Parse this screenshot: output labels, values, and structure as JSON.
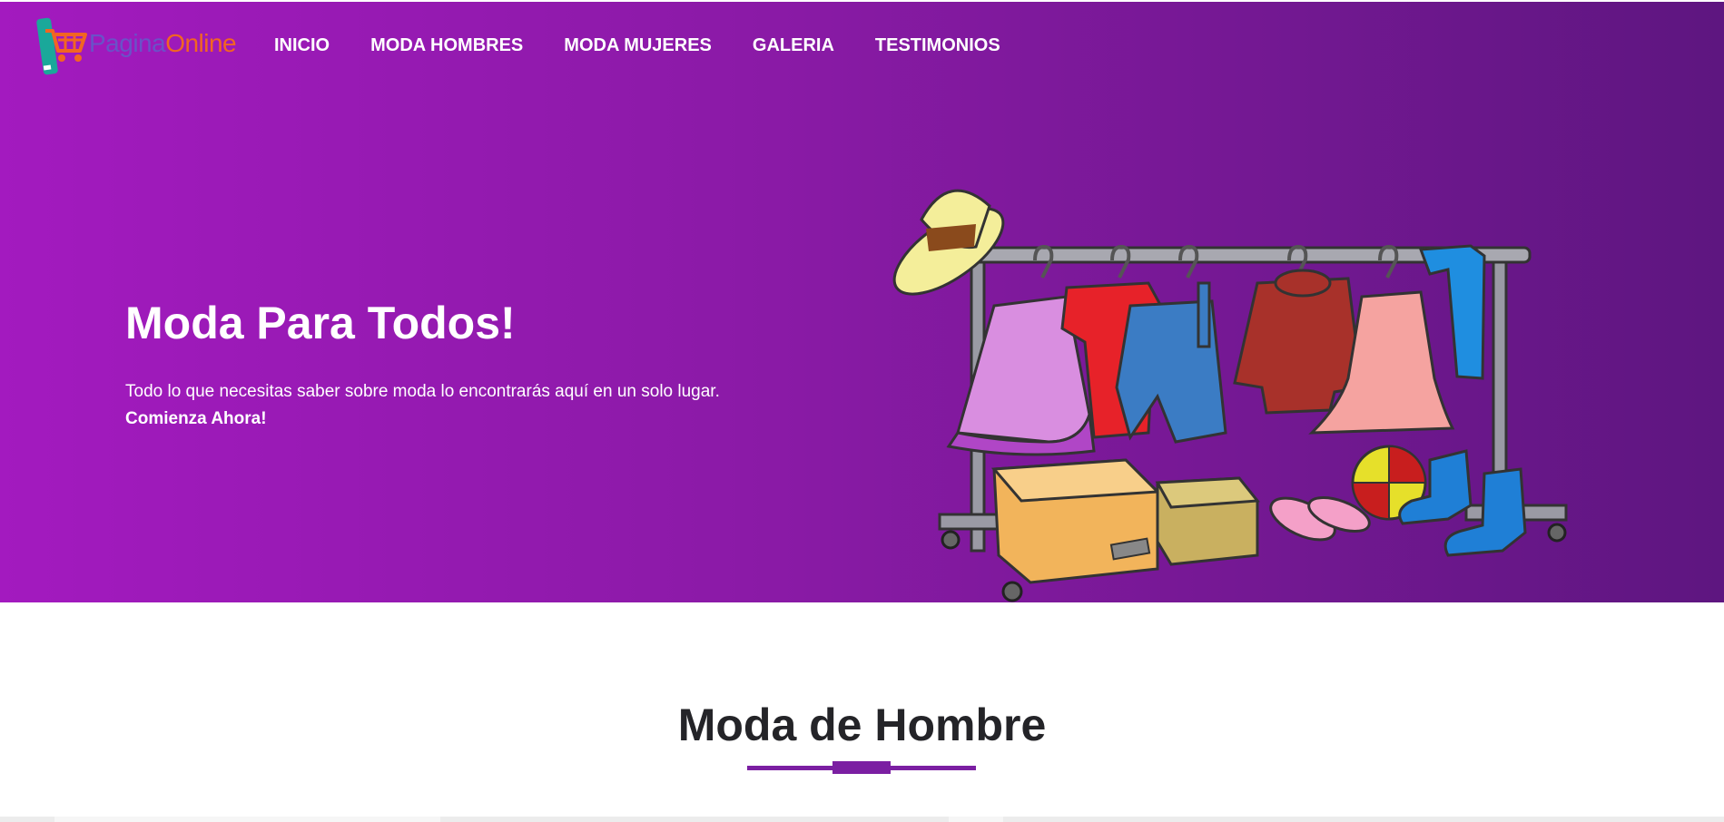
{
  "brand": {
    "name_part1": "Pagina",
    "name_part2": "Online",
    "icon": "shopping-cart-phone-logo"
  },
  "nav": {
    "items": [
      {
        "label": "INICIO"
      },
      {
        "label": "MODA HOMBRES"
      },
      {
        "label": "MODA MUJERES"
      },
      {
        "label": "GALERIA"
      },
      {
        "label": "TESTIMONIOS"
      }
    ]
  },
  "hero": {
    "title": "Moda Para Todos!",
    "description": "Todo lo que necesitas saber sobre moda lo encontrarás aquí en un solo lugar.",
    "cta": "Comienza Ahora!",
    "illustration": "clothing-rack-illustration"
  },
  "section": {
    "title": "Moda de Hombre"
  },
  "colors": {
    "hero_gradient_start": "#a31abf",
    "hero_gradient_end": "#5e1680",
    "accent": "#7b1fa2",
    "logo_blue": "#6a52c8",
    "logo_orange": "#f26522",
    "heading_dark": "#242428"
  }
}
